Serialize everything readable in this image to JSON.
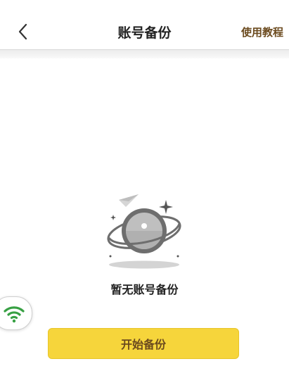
{
  "header": {
    "title": "账号备份",
    "back_icon": "chevron-left-icon",
    "tutorial_label": "使用教程"
  },
  "empty_state": {
    "illustration": "planet-icon",
    "message": "暂无账号备份"
  },
  "actions": {
    "start_backup_label": "开始备份"
  },
  "floating": {
    "icon": "wifi-icon"
  },
  "colors": {
    "accent_button": "#f6d53b",
    "accent_text": "#6b4a1e",
    "wifi": "#37a043"
  }
}
